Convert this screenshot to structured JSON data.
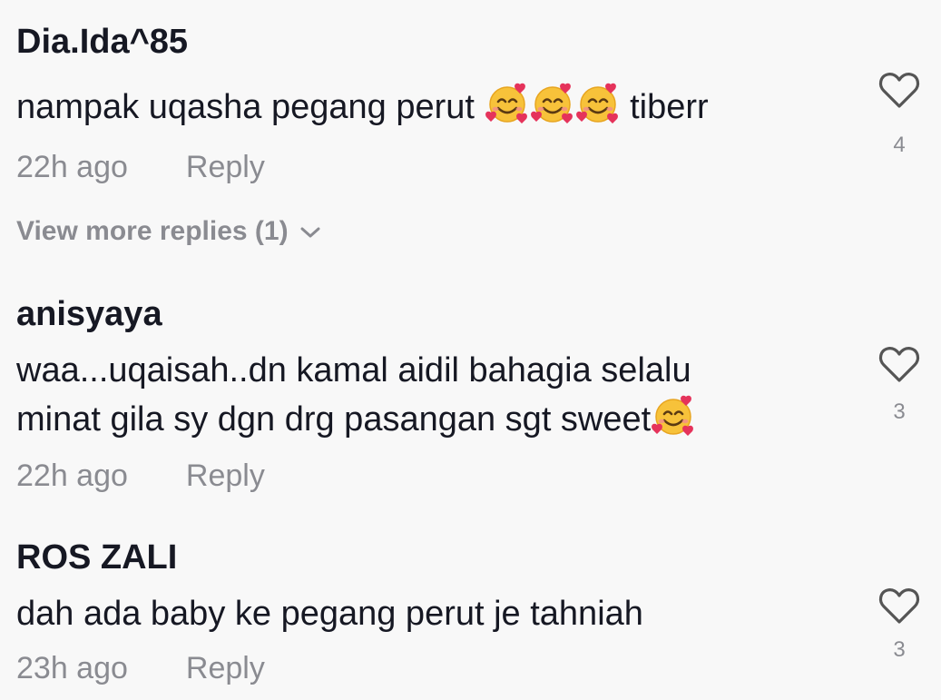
{
  "comments": [
    {
      "username": "Dia.Ida^85",
      "text_before": "nampak uqasha pegang perut ",
      "emoji": "smiling-face-with-hearts",
      "text_after": " tiberr",
      "time": "22h ago",
      "reply_label": "Reply",
      "likes": "4"
    },
    {
      "username": "anisyaya",
      "line1": "waa...uqaisah..dn kamal aidil bahagia selalu",
      "line2": "minat gila sy dgn drg pasangan sgt sweet",
      "emoji": "smiling-face-with-hearts",
      "time": "22h ago",
      "reply_label": "Reply",
      "likes": "3"
    },
    {
      "username": "ROS ZALI",
      "text": "dah ada baby ke pegang perut je tahniah",
      "time": "23h ago",
      "reply_label": "Reply",
      "likes": "3"
    }
  ],
  "view_more_replies": "View more replies (1)",
  "colors": {
    "background": "#f8f8f8",
    "text": "#161823",
    "muted": "#8a8b91",
    "emoji_face": "#f7c23a",
    "emoji_heart": "#e5335b"
  },
  "icons": {
    "like": "heart-outline-icon",
    "expand": "chevron-down-icon"
  }
}
